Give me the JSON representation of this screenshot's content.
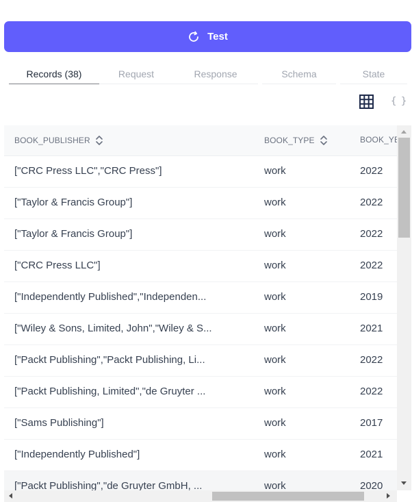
{
  "colors": {
    "accent": "#615efc",
    "tab_inactive": "#a1a6b0",
    "grid_icon": "#1e2a4a"
  },
  "toolbar": {
    "test_label": "Test",
    "test_icon": "refresh-icon"
  },
  "tabs": [
    {
      "label": "Records (38)",
      "active": true
    },
    {
      "label": "Request",
      "active": false
    },
    {
      "label": "Response",
      "active": false
    },
    {
      "label": "Schema",
      "active": false
    },
    {
      "label": "State",
      "active": false
    }
  ],
  "view_toggle": {
    "grid_icon": "grid-icon",
    "json_label": "{ }"
  },
  "table": {
    "columns": [
      "BOOK_PUBLISHER",
      "BOOK_TYPE",
      "BOOK_YE"
    ],
    "rows": [
      {
        "publisher": "[\"CRC Press LLC\",\"CRC Press\"]",
        "type": "work",
        "year": "2022"
      },
      {
        "publisher": "[\"Taylor & Francis Group\"]",
        "type": "work",
        "year": "2022"
      },
      {
        "publisher": "[\"Taylor & Francis Group\"]",
        "type": "work",
        "year": "2022"
      },
      {
        "publisher": "[\"CRC Press LLC\"]",
        "type": "work",
        "year": "2022"
      },
      {
        "publisher": "[\"Independently Published\",\"Independen...",
        "type": "work",
        "year": "2019"
      },
      {
        "publisher": "[\"Wiley & Sons, Limited, John\",\"Wiley & S...",
        "type": "work",
        "year": "2021"
      },
      {
        "publisher": "[\"Packt Publishing\",\"Packt Publishing, Li...",
        "type": "work",
        "year": "2022"
      },
      {
        "publisher": "[\"Packt Publishing, Limited\",\"de Gruyter ...",
        "type": "work",
        "year": "2022"
      },
      {
        "publisher": "[\"Sams Publishing\"]",
        "type": "work",
        "year": "2017"
      },
      {
        "publisher": "[\"Independently Published\"]",
        "type": "work",
        "year": "2021"
      },
      {
        "publisher": "[\"Packt Publishing\",\"de Gruyter GmbH, ...",
        "type": "work",
        "year": "2020"
      }
    ]
  }
}
